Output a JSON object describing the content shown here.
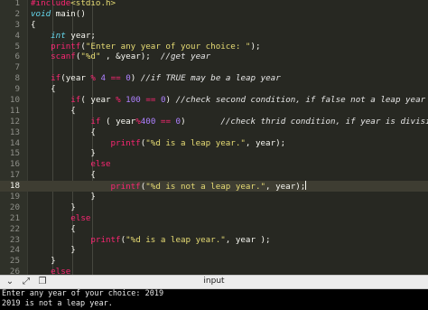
{
  "editor": {
    "active_line": 18,
    "lines": [
      {
        "n": "1",
        "t": [
          [
            "c-dir",
            "#include"
          ],
          [
            "c-inc",
            "<stdio.h>"
          ]
        ]
      },
      {
        "n": "2",
        "t": [
          [
            "c-type",
            "void"
          ],
          [
            "c-plain",
            " main()"
          ]
        ]
      },
      {
        "n": "3",
        "t": [
          [
            "c-plain",
            "{"
          ]
        ]
      },
      {
        "n": "4",
        "t": [
          [
            "c-plain",
            "    "
          ],
          [
            "c-type",
            "int"
          ],
          [
            "c-plain",
            " year;"
          ]
        ]
      },
      {
        "n": "5",
        "t": [
          [
            "c-plain",
            "    "
          ],
          [
            "c-fn",
            "printf"
          ],
          [
            "c-plain",
            "("
          ],
          [
            "c-str",
            "\"Enter any year of your choice: \""
          ],
          [
            "c-plain",
            ");"
          ]
        ]
      },
      {
        "n": "6",
        "t": [
          [
            "c-plain",
            "    "
          ],
          [
            "c-fn",
            "scanf"
          ],
          [
            "c-plain",
            "("
          ],
          [
            "c-str",
            "\"%d\""
          ],
          [
            "c-plain",
            " , &year);  "
          ],
          [
            "c-com",
            "//get year"
          ]
        ]
      },
      {
        "n": "7",
        "t": [
          [
            "c-plain",
            ""
          ]
        ]
      },
      {
        "n": "8",
        "t": [
          [
            "c-plain",
            "    "
          ],
          [
            "c-kw",
            "if"
          ],
          [
            "c-plain",
            "(year "
          ],
          [
            "c-op",
            "%"
          ],
          [
            "c-plain",
            " "
          ],
          [
            "c-num",
            "4"
          ],
          [
            "c-plain",
            " "
          ],
          [
            "c-op",
            "=="
          ],
          [
            "c-plain",
            " "
          ],
          [
            "c-num",
            "0"
          ],
          [
            "c-plain",
            ") "
          ],
          [
            "c-com",
            "//if TRUE may be a leap year"
          ]
        ]
      },
      {
        "n": "9",
        "t": [
          [
            "c-plain",
            "    {"
          ]
        ]
      },
      {
        "n": "10",
        "t": [
          [
            "c-plain",
            "        "
          ],
          [
            "c-kw",
            "if"
          ],
          [
            "c-plain",
            "( year "
          ],
          [
            "c-op",
            "%"
          ],
          [
            "c-plain",
            " "
          ],
          [
            "c-num",
            "100"
          ],
          [
            "c-plain",
            " "
          ],
          [
            "c-op",
            "=="
          ],
          [
            "c-plain",
            " "
          ],
          [
            "c-num",
            "0"
          ],
          [
            "c-plain",
            ") "
          ],
          [
            "c-com",
            "//check second condition, if false not a leap year"
          ]
        ]
      },
      {
        "n": "11",
        "t": [
          [
            "c-plain",
            "        {"
          ]
        ]
      },
      {
        "n": "12",
        "t": [
          [
            "c-plain",
            "            "
          ],
          [
            "c-kw",
            "if"
          ],
          [
            "c-plain",
            " ( year"
          ],
          [
            "c-op",
            "%"
          ],
          [
            "c-num",
            "400"
          ],
          [
            "c-plain",
            " "
          ],
          [
            "c-op",
            "=="
          ],
          [
            "c-plain",
            " "
          ],
          [
            "c-num",
            "0"
          ],
          [
            "c-plain",
            ")       "
          ],
          [
            "c-com",
            "//check thrid condition, if year is divisible"
          ]
        ]
      },
      {
        "n": "13",
        "t": [
          [
            "c-plain",
            "            {"
          ]
        ]
      },
      {
        "n": "14",
        "t": [
          [
            "c-plain",
            "                "
          ],
          [
            "c-fn",
            "printf"
          ],
          [
            "c-plain",
            "("
          ],
          [
            "c-str",
            "\"%d is a leap year.\""
          ],
          [
            "c-plain",
            ", year);"
          ]
        ]
      },
      {
        "n": "15",
        "t": [
          [
            "c-plain",
            "            }"
          ]
        ]
      },
      {
        "n": "16",
        "t": [
          [
            "c-plain",
            "            "
          ],
          [
            "c-kw",
            "else"
          ]
        ]
      },
      {
        "n": "17",
        "t": [
          [
            "c-plain",
            "            {"
          ]
        ]
      },
      {
        "n": "18",
        "t": [
          [
            "c-plain",
            "                "
          ],
          [
            "c-fn",
            "printf"
          ],
          [
            "c-plain",
            "("
          ],
          [
            "c-str",
            "\"%d is not a leap year.\""
          ],
          [
            "c-plain",
            ", year);"
          ]
        ]
      },
      {
        "n": "19",
        "t": [
          [
            "c-plain",
            "            }"
          ]
        ]
      },
      {
        "n": "20",
        "t": [
          [
            "c-plain",
            "        }"
          ]
        ]
      },
      {
        "n": "21",
        "t": [
          [
            "c-plain",
            "        "
          ],
          [
            "c-kw",
            "else"
          ]
        ]
      },
      {
        "n": "22",
        "t": [
          [
            "c-plain",
            "        {"
          ]
        ]
      },
      {
        "n": "23",
        "t": [
          [
            "c-plain",
            "            "
          ],
          [
            "c-fn",
            "printf"
          ],
          [
            "c-plain",
            "("
          ],
          [
            "c-str",
            "\"%d is a leap year.\""
          ],
          [
            "c-plain",
            ", year );"
          ]
        ]
      },
      {
        "n": "24",
        "t": [
          [
            "c-plain",
            "        }"
          ]
        ]
      },
      {
        "n": "25",
        "t": [
          [
            "c-plain",
            "    }"
          ]
        ]
      },
      {
        "n": "26",
        "t": [
          [
            "c-plain",
            "    "
          ],
          [
            "c-kw",
            "else"
          ]
        ]
      }
    ]
  },
  "toolbar": {
    "title": "input",
    "buttons": [
      {
        "name": "collapse-chevron-icon",
        "glyph": "⌄"
      },
      {
        "name": "expand-arrows-icon",
        "glyph": "⤢"
      },
      {
        "name": "copy-icon",
        "glyph": "❐"
      }
    ]
  },
  "console": {
    "lines": [
      "Enter any year of your choice: 2019",
      "2019 is not a leap year."
    ]
  }
}
